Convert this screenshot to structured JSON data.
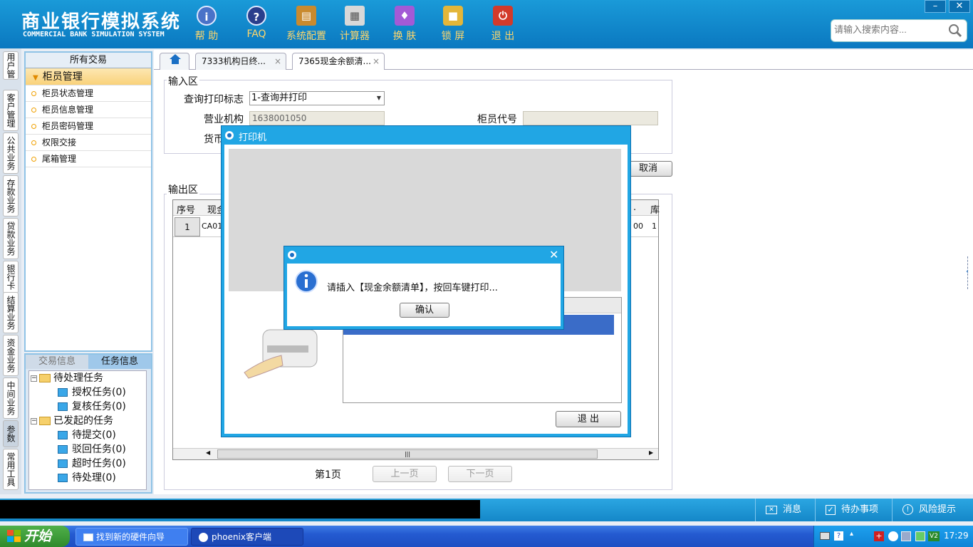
{
  "header": {
    "title_cn": "商业银行模拟系统",
    "title_en": "COMMERCIAL BANK SIMULATION SYSTEM",
    "toolbar": [
      {
        "label": "帮 助",
        "icon": "info-icon"
      },
      {
        "label": "FAQ",
        "icon": "faq-icon"
      },
      {
        "label": "系统配置",
        "icon": "toolbox-icon"
      },
      {
        "label": "计算器",
        "icon": "calculator-icon"
      },
      {
        "label": "换 肤",
        "icon": "shirt-icon"
      },
      {
        "label": "锁 屏",
        "icon": "lock-icon"
      },
      {
        "label": "退 出",
        "icon": "power-icon"
      }
    ],
    "search_placeholder": "请输入搜索内容...",
    "minimize": "–",
    "close": "✕"
  },
  "vtabs": [
    "用户管理",
    "客户管理",
    "公共业务",
    "存款业务",
    "贷款业务",
    "银行卡业务",
    "结算业务",
    "资金业务",
    "中间业务",
    "参数",
    "常用工具"
  ],
  "left_menu": {
    "header": "所有交易",
    "group": "柜员管理",
    "items": [
      "柜员状态管理",
      "柜员信息管理",
      "柜员密码管理",
      "权限交接",
      "尾箱管理"
    ]
  },
  "task_panel": {
    "tab_inactive": "交易信息",
    "tab_active": "任务信息",
    "tree": {
      "pending": "待处理任务",
      "auth": "授权任务(0)",
      "review": "复核任务(0)",
      "initiated": "已发起的任务",
      "to_submit": "待提交(0)",
      "rejected": "驳回任务(0)",
      "timeout": "超时任务(0)",
      "to_process": "待处理(0)"
    }
  },
  "tabs": [
    "7333机构日终...",
    "7365现金余额清..."
  ],
  "input_area": {
    "legend": "输入区",
    "query_flag_label": "查询打印标志",
    "query_flag_value": "1-查询并打印",
    "org_label": "营业机构",
    "org_value": "1638001050",
    "teller_label": "柜员代号",
    "teller_value": "",
    "currency_label": "货币",
    "cancel_btn": "取消"
  },
  "output_area": {
    "legend": "输出区",
    "columns": [
      "序号",
      "现金",
      ".",
      "库"
    ],
    "row": {
      "no": "1",
      "cash": "CA01",
      "col3": "00",
      "col4": "1"
    }
  },
  "pager": {
    "page": "第1页",
    "prev": "上一页",
    "next": "下一页"
  },
  "printer_dialog": {
    "title": "打印机",
    "exit_btn": "退  出"
  },
  "message_box": {
    "text": "请插入【现金余额清单】，按回车键打印...",
    "ok_btn": "确认"
  },
  "status_bar": {
    "messages": "消息",
    "todo": "待办事项",
    "risk": "风险提示"
  },
  "taskbar": {
    "start": "开始",
    "tasks": [
      "找到新的硬件向导",
      "phoenix客户端"
    ],
    "clock": "17:29"
  }
}
